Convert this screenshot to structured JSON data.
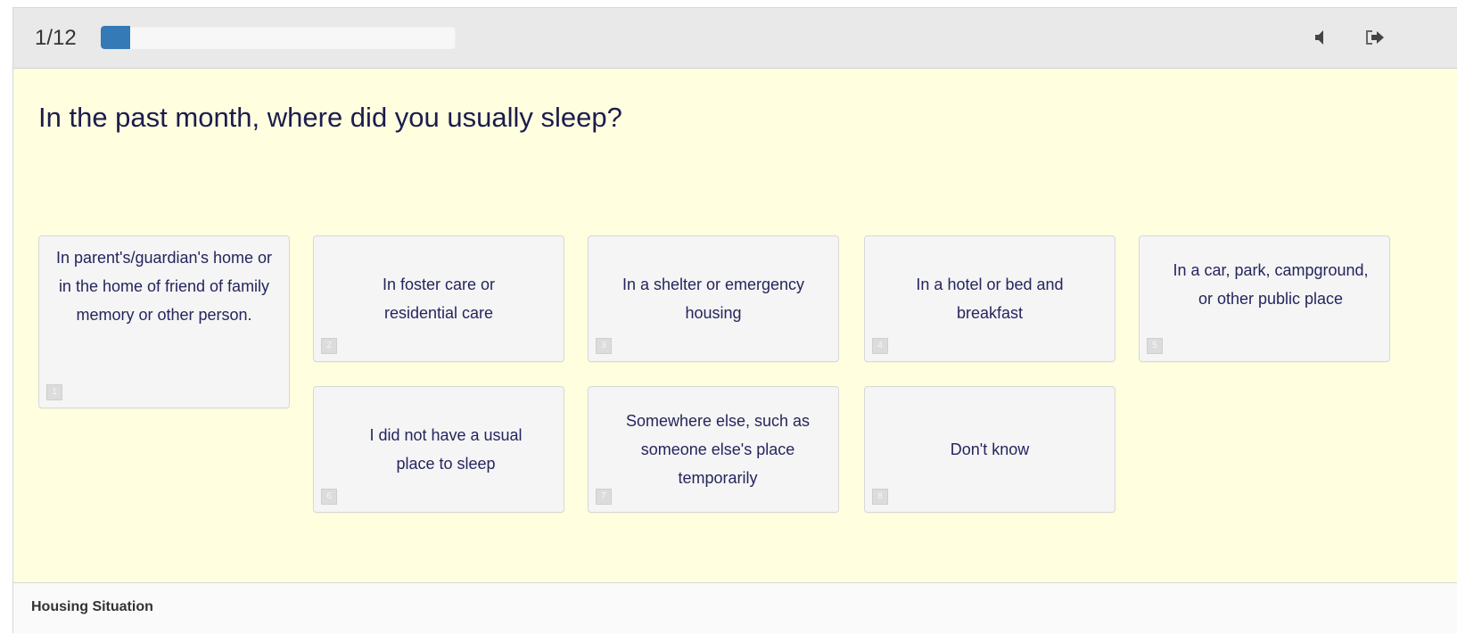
{
  "header": {
    "counter": "1/12",
    "progress": 0.083,
    "accent_color": "#337ab7",
    "icons": [
      "speaker-icon",
      "exit-icon"
    ]
  },
  "question": {
    "text": "In the past month, where did you usually sleep?"
  },
  "options": [
    {
      "label": "In parent's/guardian's home or in the home of friend of family memory or other person.",
      "key": "1"
    },
    {
      "label": "In foster care or residential care",
      "key": "2"
    },
    {
      "label": "In a shelter or emergency housing",
      "key": "3"
    },
    {
      "label": "In a hotel or bed and breakfast",
      "key": "4"
    },
    {
      "label": "In a car, park, campground, or other public place",
      "key": "5"
    },
    {
      "label": "I did not have a usual place to sleep",
      "key": "6"
    },
    {
      "label": "Somewhere else, such as someone else's place temporarily",
      "key": "7"
    },
    {
      "label": "Don't know",
      "key": "8"
    }
  ],
  "footer": {
    "section_label": "Housing Situation"
  }
}
